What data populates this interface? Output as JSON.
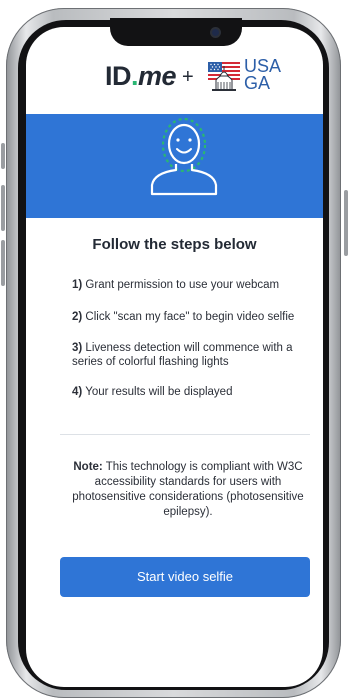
{
  "brand": {
    "idme_prefix": "ID",
    "idme_dot": ".",
    "idme_suffix": "me",
    "plus": "+",
    "partner_line1": "USA",
    "partner_line2": "GA",
    "partner_color": "#2d5fa8",
    "idme_color": "#232a35",
    "idme_accent": "#2ab673"
  },
  "banner": {
    "color": "#2f75d6",
    "icon": "face-scan-icon"
  },
  "heading": "Follow the steps below",
  "steps": [
    {
      "num": "1)",
      "text": " Grant permission to use your webcam"
    },
    {
      "num": "2)",
      "text": " Click \"scan my face\" to begin video selfie"
    },
    {
      "num": "3)",
      "text": " Liveness detection will commence with a series of colorful flashing lights"
    },
    {
      "num": "4)",
      "text": " Your results will be displayed"
    }
  ],
  "note": {
    "label": "Note:",
    "text": " This technology is compliant with W3C accessibility standards for users with photosensitive considerations (photosensitive epilepsy)."
  },
  "actions": {
    "start_label": "Start video selfie"
  }
}
